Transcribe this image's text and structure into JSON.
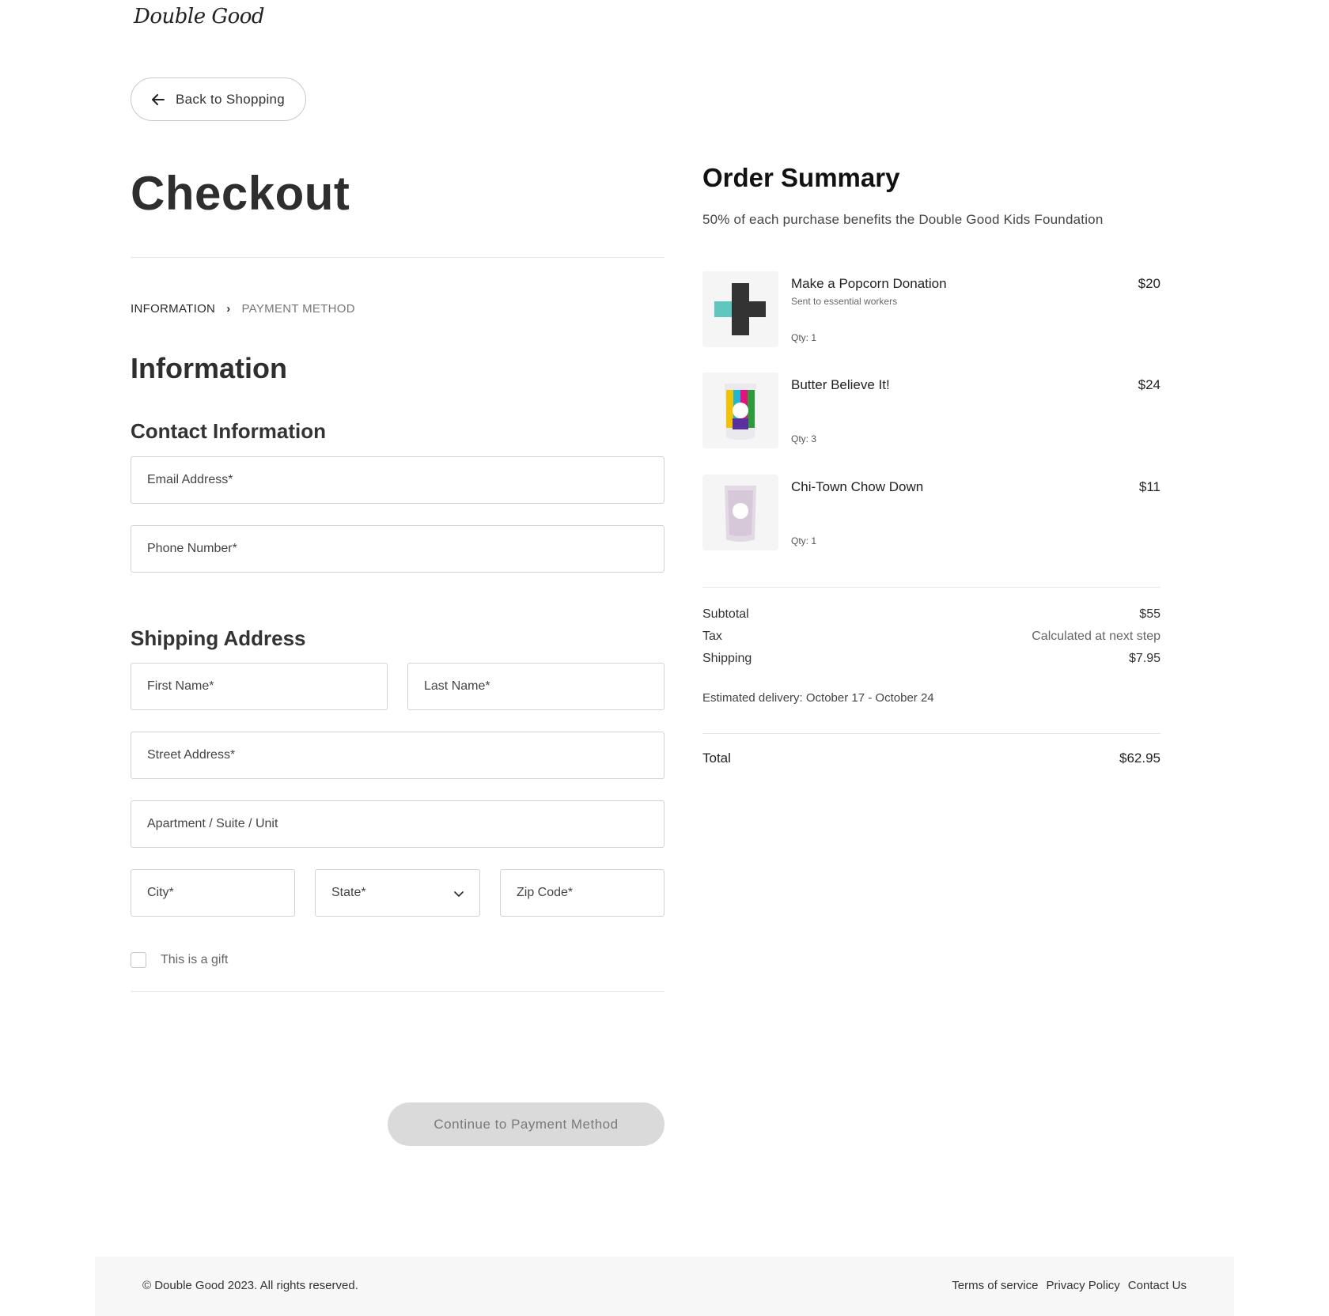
{
  "brand": {
    "logo_text": "Double Good"
  },
  "back_button": {
    "label": "Back to Shopping",
    "icon": "arrow-left-icon"
  },
  "page_title": "Checkout",
  "breadcrumb": {
    "active": "INFORMATION",
    "separator": "›",
    "inactive": "PAYMENT METHOD"
  },
  "section_title": "Information",
  "contact": {
    "title": "Contact Information",
    "email_placeholder": "Email Address*",
    "phone_placeholder": "Phone Number*"
  },
  "shipping": {
    "title": "Shipping Address",
    "first_name_placeholder": "First Name*",
    "last_name_placeholder": "Last Name*",
    "street_placeholder": "Street Address*",
    "apt_placeholder": "Apartment / Suite / Unit",
    "city_placeholder": "City*",
    "state_selected": "State*",
    "zip_placeholder": "Zip Code*"
  },
  "gift": {
    "label": "This is a gift",
    "checked": false
  },
  "continue_button": {
    "label": "Continue to Payment Method"
  },
  "order_summary": {
    "title": "Order Summary",
    "subtitle": "50% of each purchase benefits the Double Good Kids Foundation",
    "items": [
      {
        "name": "Make a Popcorn Donation",
        "note": "Sent to essential workers",
        "qty": "Qty: 1",
        "price": "$20"
      },
      {
        "name": "Butter Believe It!",
        "note": "",
        "qty": "Qty: 3",
        "price": "$24"
      },
      {
        "name": "Chi-Town Chow Down",
        "note": "",
        "qty": "Qty: 1",
        "price": "$11"
      }
    ],
    "subtotal_label": "Subtotal",
    "subtotal_value": "$55",
    "tax_label": "Tax",
    "tax_value": "Calculated at next step",
    "shipping_label": "Shipping",
    "shipping_value": "$7.95",
    "estimated_delivery": "Estimated delivery: October 17 - October 24",
    "total_label": "Total",
    "total_value": "$62.95"
  },
  "footer": {
    "copyright": "© Double Good 2023. All rights reserved.",
    "links": [
      "Terms of service",
      "Privacy Policy",
      "Contact Us"
    ]
  },
  "colors": {
    "accent_teal": "#5ec8bf",
    "disabled_button": "#dadada",
    "border": "#d3d3d3"
  }
}
